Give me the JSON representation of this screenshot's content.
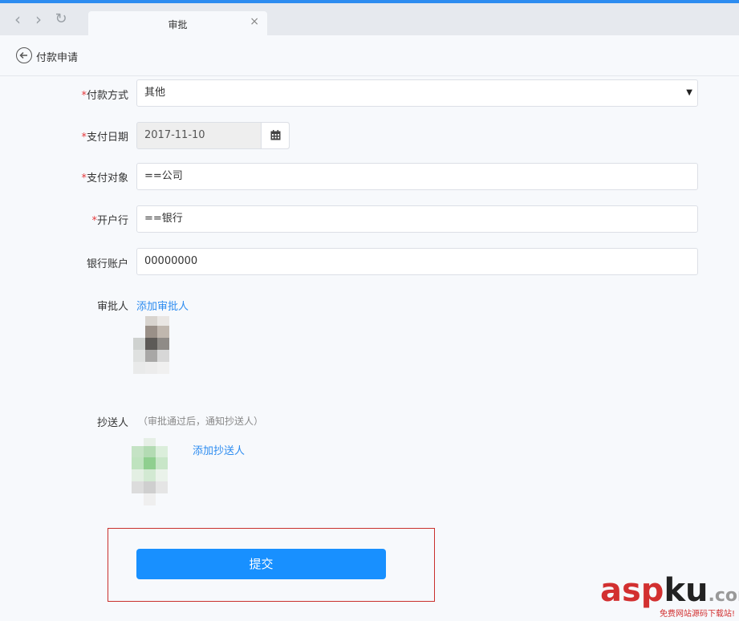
{
  "browser": {
    "tab_title": "审批",
    "tab_close": "×",
    "back_glyph": "‹",
    "forward_glyph": "›",
    "reload_glyph": "↻"
  },
  "header": {
    "title": "付款申请",
    "back_icon": "circle-arrow-left-icon"
  },
  "form": {
    "required_mark": "*",
    "payment_method": {
      "label": "付款方式",
      "value": "其他",
      "arrow": "▼"
    },
    "pay_date": {
      "label": "支付日期",
      "value": "2017-11-10",
      "icon": "calendar-icon"
    },
    "payee": {
      "label": "支付对象",
      "value": "==公司"
    },
    "bank": {
      "label": "开户行",
      "value": "==银行"
    },
    "account": {
      "label": "银行账户",
      "value": "00000000"
    },
    "approver": {
      "label": "审批人",
      "add_link": "添加审批人"
    },
    "cc": {
      "label": "抄送人",
      "hint": "（审批通过后，通知抄送人）",
      "add_link": "添加抄送人"
    },
    "submit_label": "提交"
  },
  "watermark": {
    "logo_a": "asp",
    "logo_b": "ku",
    "logo_c": ".com",
    "slogan": "免费网站源码下载站!"
  },
  "colors": {
    "accent": "#1890ff",
    "link": "#2d8cf0",
    "required": "#e4393c",
    "highlight_border": "#c9302c"
  }
}
